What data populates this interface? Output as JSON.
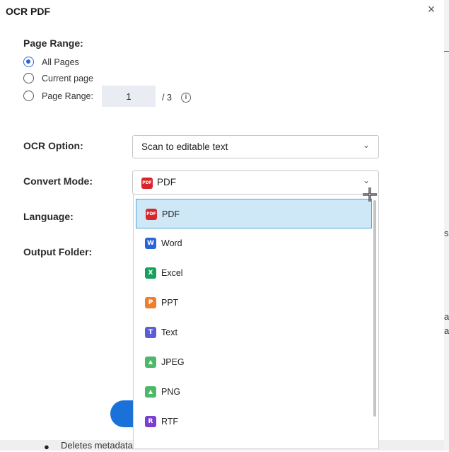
{
  "dialog": {
    "title": "OCR PDF",
    "close_glyph": "×"
  },
  "page_range": {
    "label": "Page Range:",
    "options": [
      "All Pages",
      "Current page",
      "Page Range:"
    ],
    "selected_index": 0,
    "input_value": "1",
    "total": "/ 3",
    "info_glyph": "i"
  },
  "ocr_option": {
    "label": "OCR Option:",
    "value": "Scan to editable text",
    "chevron": "⌄"
  },
  "convert_mode": {
    "label": "Convert Mode:",
    "value": "PDF",
    "value_icon": "pdf-icon",
    "chevron": "⌄",
    "dropdown_items": [
      {
        "label": "PDF",
        "icon": "pdf-icon",
        "glyph": "PDF",
        "color": "#d9262c",
        "selected": true
      },
      {
        "label": "Word",
        "icon": "word-icon",
        "glyph": "W",
        "color": "#2b63d9",
        "selected": false
      },
      {
        "label": "Excel",
        "icon": "excel-icon",
        "glyph": "X",
        "color": "#16a05c",
        "selected": false
      },
      {
        "label": "PPT",
        "icon": "ppt-icon",
        "glyph": "P",
        "color": "#f07f2d",
        "selected": false
      },
      {
        "label": "Text",
        "icon": "text-icon",
        "glyph": "T",
        "color": "#5b5fd6",
        "selected": false
      },
      {
        "label": "JPEG",
        "icon": "image-icon",
        "glyph": "▲",
        "color": "#4cb86a",
        "selected": false
      },
      {
        "label": "PNG",
        "icon": "image-icon",
        "glyph": "▲",
        "color": "#4cb86a",
        "selected": false
      },
      {
        "label": "RTF",
        "icon": "rtf-icon",
        "glyph": "R",
        "color": "#7a3fd0",
        "selected": false
      }
    ]
  },
  "language": {
    "label": "Language:"
  },
  "output_folder": {
    "label": "Output Folder:"
  },
  "background": {
    "right_chars": [
      "s",
      "a",
      "a"
    ],
    "bottom_bullet": "●",
    "bottom_text": "Deletes metadata"
  },
  "colors": {
    "accent": "#2a64d6",
    "selected_bg": "#cfe8f7",
    "selected_border": "#4aa6df",
    "button": "#1a72d8"
  }
}
